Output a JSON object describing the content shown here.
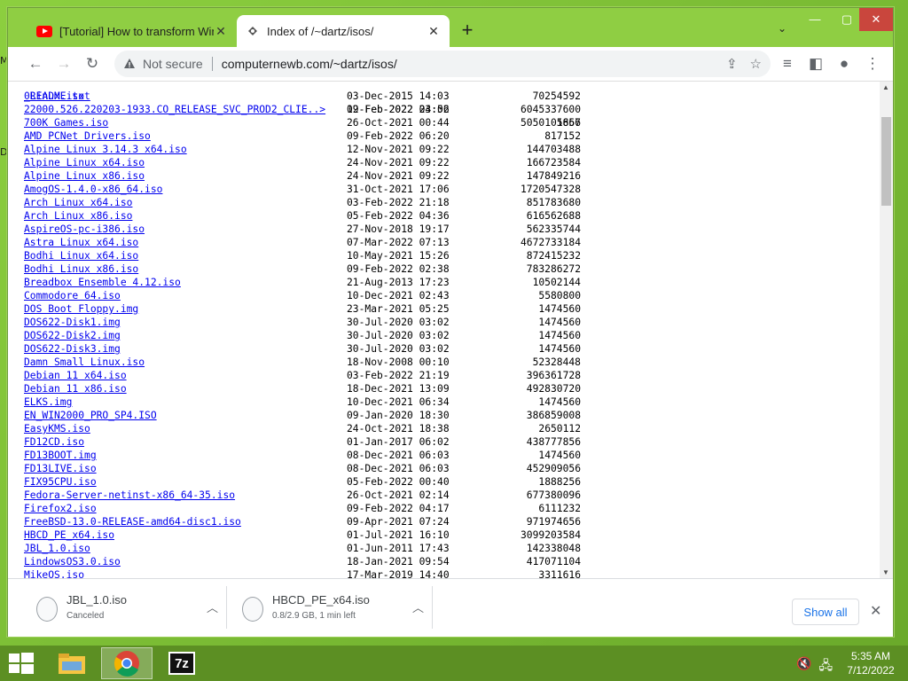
{
  "browser": {
    "tabs": [
      {
        "label": "[Tutorial] How to transform Wind",
        "icon": "youtube-icon",
        "active": false
      },
      {
        "label": "Index of /~dartz/isos/",
        "icon": "page-icon",
        "active": true
      }
    ],
    "new_tab": "+",
    "security_label": "Not secure",
    "url": "computernewb.com/~dartz/isos/"
  },
  "listing": {
    "partial_top": {
      "name": "_README.txt",
      "date": "09-Feb-2022 04:02",
      "size": "1667"
    },
    "rows": [
      {
        "name": "0Linux.iso",
        "date": "03-Dec-2015 14:03",
        "size": "70254592"
      },
      {
        "name": "22000.526.220203-1933.CO_RELEASE_SVC_PROD2_CLIE..>",
        "date": "12-Feb-2022 23:56",
        "size": "6045337600"
      },
      {
        "name": "700K Games.iso",
        "date": "26-Oct-2021 00:44",
        "size": "5050105856"
      },
      {
        "name": "AMD PCNet Drivers.iso",
        "date": "09-Feb-2022 06:20",
        "size": "817152"
      },
      {
        "name": "Alpine Linux 3.14.3 x64.iso",
        "date": "12-Nov-2021 09:22",
        "size": "144703488"
      },
      {
        "name": "Alpine Linux x64.iso",
        "date": "24-Nov-2021 09:22",
        "size": "166723584"
      },
      {
        "name": "Alpine Linux x86.iso",
        "date": "24-Nov-2021 09:22",
        "size": "147849216"
      },
      {
        "name": "AmogOS-1.4.0-x86_64.iso",
        "date": "31-Oct-2021 17:06",
        "size": "1720547328"
      },
      {
        "name": "Arch Linux x64.iso",
        "date": "03-Feb-2022 21:18",
        "size": "851783680"
      },
      {
        "name": "Arch Linux x86.iso",
        "date": "05-Feb-2022 04:36",
        "size": "616562688"
      },
      {
        "name": "AspireOS-pc-i386.iso",
        "date": "27-Nov-2018 19:17",
        "size": "562335744"
      },
      {
        "name": "Astra Linux x64.iso",
        "date": "07-Mar-2022 07:13",
        "size": "4672733184"
      },
      {
        "name": "Bodhi Linux x64.iso",
        "date": "10-May-2021 15:26",
        "size": "872415232"
      },
      {
        "name": "Bodhi Linux x86.iso",
        "date": "09-Feb-2022 02:38",
        "size": "783286272"
      },
      {
        "name": "Breadbox Ensemble 4.12.iso",
        "date": "21-Aug-2013 17:23",
        "size": "10502144"
      },
      {
        "name": "Commodore 64.iso",
        "date": "10-Dec-2021 02:43",
        "size": "5580800"
      },
      {
        "name": "DOS Boot Floppy.img",
        "date": "23-Mar-2021 05:25",
        "size": "1474560"
      },
      {
        "name": "DOS622-Disk1.img",
        "date": "30-Jul-2020 03:02",
        "size": "1474560"
      },
      {
        "name": "DOS622-Disk2.img",
        "date": "30-Jul-2020 03:02",
        "size": "1474560"
      },
      {
        "name": "DOS622-Disk3.img",
        "date": "30-Jul-2020 03:02",
        "size": "1474560"
      },
      {
        "name": "Damn Small Linux.iso",
        "date": "18-Nov-2008 00:10",
        "size": "52328448"
      },
      {
        "name": "Debian 11 x64.iso",
        "date": "03-Feb-2022 21:19",
        "size": "396361728"
      },
      {
        "name": "Debian 11 x86.iso",
        "date": "18-Dec-2021 13:09",
        "size": "492830720"
      },
      {
        "name": "ELKS.img",
        "date": "10-Dec-2021 06:34",
        "size": "1474560"
      },
      {
        "name": "EN_WIN2000_PRO_SP4.ISO",
        "date": "09-Jan-2020 18:30",
        "size": "386859008"
      },
      {
        "name": "EasyKMS.iso",
        "date": "24-Oct-2021 18:38",
        "size": "2650112"
      },
      {
        "name": "FD12CD.iso",
        "date": "01-Jan-2017 06:02",
        "size": "438777856"
      },
      {
        "name": "FD13BOOT.img",
        "date": "08-Dec-2021 06:03",
        "size": "1474560"
      },
      {
        "name": "FD13LIVE.iso",
        "date": "08-Dec-2021 06:03",
        "size": "452909056"
      },
      {
        "name": "FIX95CPU.iso",
        "date": "05-Feb-2022 00:40",
        "size": "1888256"
      },
      {
        "name": "Fedora-Server-netinst-x86_64-35.iso",
        "date": "26-Oct-2021 02:14",
        "size": "677380096"
      },
      {
        "name": "Firefox2.iso",
        "date": "09-Feb-2022 04:17",
        "size": "6111232"
      },
      {
        "name": "FreeBSD-13.0-RELEASE-amd64-disc1.iso",
        "date": "09-Apr-2021 07:24",
        "size": "971974656"
      },
      {
        "name": "HBCD_PE_x64.iso",
        "date": "01-Jul-2021 16:10",
        "size": "3099203584"
      },
      {
        "name": "JBL_1.0.iso",
        "date": "01-Jun-2011 17:43",
        "size": "142338048"
      },
      {
        "name": "LindowsOS3.0.iso",
        "date": "18-Jan-2021 09:54",
        "size": "417071104"
      },
      {
        "name": "MikeOS.iso",
        "date": "17-Mar-2019 14:40",
        "size": "3311616"
      }
    ]
  },
  "downloads": {
    "items": [
      {
        "name": "JBL_1.0.iso",
        "status": "Canceled"
      },
      {
        "name": "HBCD_PE_x64.iso",
        "status": "0.8/2.9 GB, 1 min left"
      }
    ],
    "show_all": "Show all"
  },
  "taskbar": {
    "apps": [
      "file-explorer-icon",
      "chrome-icon",
      "7zip-icon"
    ],
    "sevenz_label": "7z",
    "time": "5:35 AM",
    "date": "7/12/2022"
  },
  "desktop": {
    "letters": [
      "M",
      "D"
    ]
  }
}
